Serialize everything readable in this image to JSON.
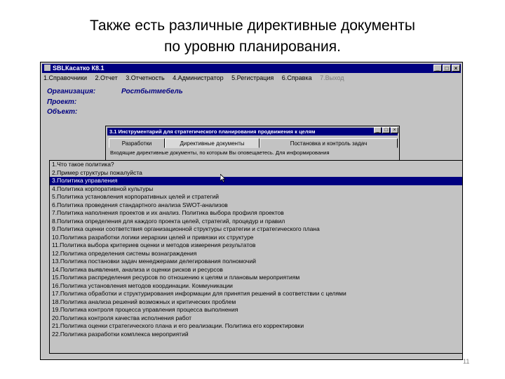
{
  "slide": {
    "title_line1": "Также есть различные директивные документы",
    "title_line2": "по уровню планирования.",
    "page_number": "11"
  },
  "window": {
    "title": "SBLКасатко К8.1",
    "min": "_",
    "max": "□",
    "close": "×"
  },
  "menu": [
    "1.Справочники",
    "2.Отчет",
    "3.Отчетность",
    "4.Администратор",
    "5.Регистрация",
    "6.Справка",
    "7.Выход"
  ],
  "info": {
    "org_label": "Организация:",
    "org_value": "Ростбытмебель",
    "project_label": "Проект:",
    "object_label": "Объект:"
  },
  "subwindow": {
    "title": "3.1 Инструментарий для стратегического планирования продвижения к целям",
    "tabs": [
      "Разработки",
      "Директивные документы",
      "Постановка и контроль задач"
    ],
    "text": "Входящие директивные документы, по которым Вы оповещаетесь. Для информирования"
  },
  "list": [
    "1.Что такое политика?",
    "2.Пример структуры пожалуйста",
    "3.Политика управления",
    "4.Политика корпоративной культуры",
    "5.Политика установления корпоративных целей и стратегий",
    "6.Политика проведения стандартного анализа SWOT-анализов",
    "7.Политика наполнения проектов и их анализ. Политика выбора профиля проектов",
    "8.Политика определения для каждого проекта целей, стратегий, процедур и правил",
    "9.Политика оценки соответствия организационной структуры стратегии и стратегического плана",
    "10.Политика разработки логики иерархии целей и привязки их структуре",
    "11.Политика выбора критериев оценки и методов измерения результатов",
    "12.Политика определения системы вознаграждения",
    "13.Политика постановки задач менеджерами делегирования полномочий",
    "14.Политика выявления, анализа и оценки рисков и ресурсов",
    "15.Политика распределения ресурсов по отношению к целям и плановым мероприятиям",
    "16.Политика установления методов координации. Коммуникации",
    "17.Политика обработки и структурирования информации для принятия решений в соответствии с целями",
    "18.Политика анализа решений возможных и критических проблем",
    "19.Политика контроля процесса управления процесса выполнения",
    "20.Политика контроля качества исполнения работ",
    "21.Политика оценки стратегического плана и его реализации. Политика его корректировки",
    "22.Политика разработки комплекса мероприятий"
  ],
  "selected_index": 2
}
